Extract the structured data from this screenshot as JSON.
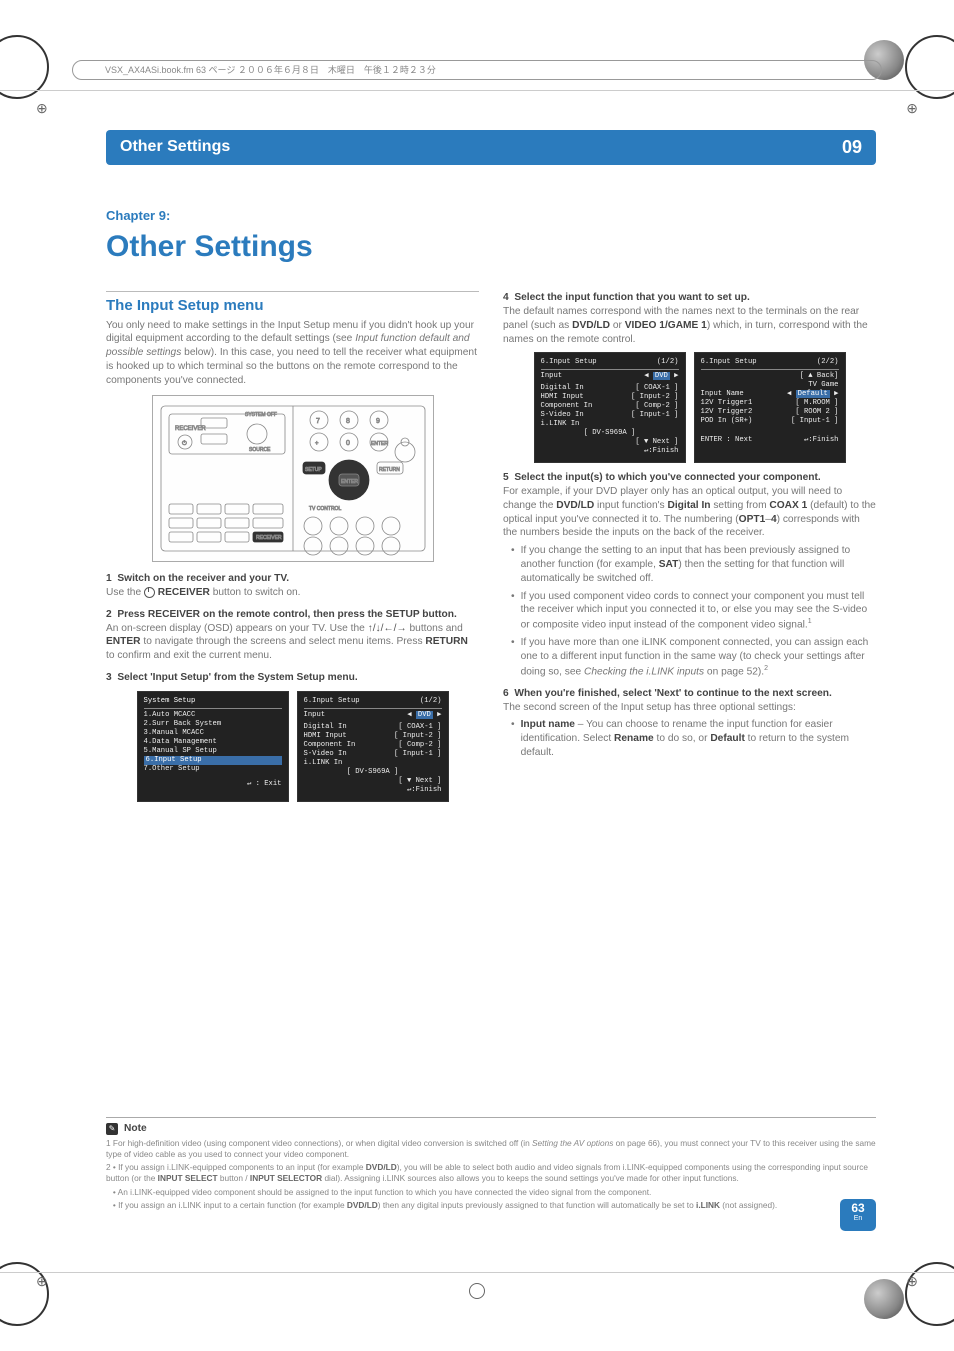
{
  "bookline": "VSX_AX4ASi.book.fm  63 ページ  ２００６年６月８日　木曜日　午後１２時２３分",
  "section_bar": {
    "title": "Other Settings",
    "num": "09"
  },
  "chapter": {
    "label": "Chapter 9:",
    "title": "Other Settings"
  },
  "h2": "The Input Setup menu",
  "intro": "You only need to make settings in the Input Setup menu if you didn't hook up your digital equipment according to the default settings (see ",
  "intro_em": "Input function default and possible settings",
  "intro2": " below). In this case, you need to tell the receiver what equipment is hooked up to which terminal so the buttons on the remote correspond to the components you've connected.",
  "step1_num": "1",
  "step1": "Switch on the receiver and your TV.",
  "step1_body_a": "Use the ",
  "step1_body_b": " RECEIVER",
  "step1_body_c": " button to switch on.",
  "step2_num": "2",
  "step2": "Press RECEIVER on the remote control, then press the SETUP button.",
  "step2_body_a": "An on-screen display (OSD) appears on your TV. Use the ",
  "step2_body_b": " buttons and ",
  "step2_body_c": "ENTER",
  "step2_body_d": " to navigate through the screens and select menu items. Press ",
  "step2_body_e": "RETURN",
  "step2_body_f": " to confirm and exit the current menu.",
  "step3_num": "3",
  "step3": "Select 'Input Setup' from the System Setup menu.",
  "osd_sys": {
    "title": "System  Setup",
    "items": [
      "1.Auto  MCACC",
      "2.Surr  Back  System",
      "3.Manual  MCACC",
      "4.Data  Management",
      "5.Manual  SP  Setup",
      "6.Input  Setup",
      "7.Other  Setup"
    ],
    "exit": ": Exit"
  },
  "osd_in1": {
    "title": "6.Input  Setup",
    "page": "(1/2)",
    "inputlbl": "Input",
    "inputval": "DVD",
    "rows": [
      [
        "Digital  In",
        "COAX-1"
      ],
      [
        "HDMI  Input",
        "Input-2"
      ],
      [
        "Component  In",
        "Comp-2"
      ],
      [
        "S-Video  In",
        "Input-1"
      ],
      [
        "i.LINK  In",
        ""
      ],
      [
        "",
        "DV-S969A"
      ]
    ],
    "next": "[ ▼ Next ]",
    "finish": ":Finish"
  },
  "step4_num": "4",
  "step4": "Select the input function that you want to set up.",
  "step4_body_a": "The default names correspond with the names next to the terminals on the rear panel (such as ",
  "step4_body_b": "DVD/LD",
  "step4_body_c": " or ",
  "step4_body_d": "VIDEO 1/GAME 1",
  "step4_body_e": ") which, in turn, correspond with the names on the remote control.",
  "osd_in1b_title": "6.Input  Setup",
  "osd_in2": {
    "title": "6.Input  Setup",
    "page": "(2/2)",
    "back": "[ ▲ Back]",
    "tvgame": "TV Game",
    "rows": [
      [
        "Input  Name",
        "Default"
      ],
      [
        "12V  Trigger1",
        "M.ROOM"
      ],
      [
        "12V  Trigger2",
        "ROOM 2"
      ],
      [
        "POD  In  (SR+)",
        "Input-1"
      ]
    ],
    "enter": "ENTER : Next",
    "finish": ":Finish"
  },
  "step5_num": "5",
  "step5": "Select the input(s) to which you've connected your component.",
  "step5_body_a": "For example, if your DVD player only has an optical output, you will need to change the ",
  "step5_body_b": "DVD/LD",
  "step5_body_c": " input function's ",
  "step5_body_d": "Digital In",
  "step5_body_e": " setting from ",
  "step5_body_f": "COAX 1",
  "step5_body_g": " (default) to the optical input you've connected it to. The numbering (",
  "step5_body_h": "OPT1",
  "step5_body_i": "–",
  "step5_body_j": "4",
  "step5_body_k": ") corresponds with the numbers beside the inputs on the back of the receiver.",
  "b1_a": "If you change the setting to an input that has been previously assigned to another function (for example, ",
  "b1_b": "SAT",
  "b1_c": ") then the setting for that function will automatically be switched off.",
  "b2": "If you used component video cords to connect your component you must tell the receiver which input you connected it to, or else you may see the S-video or composite video input instead of the component video signal.",
  "b2_sup": "1",
  "b3_a": "If you have more than one iLINK component connected, you can assign each one to a different input function in the same way (to check your settings after doing so, see ",
  "b3_em": "Checking the i.LINK inputs",
  "b3_b": " on page 52).",
  "b3_sup": "2",
  "step6_num": "6",
  "step6": "When you're finished, select 'Next' to continue to the next screen.",
  "step6_body": "The second screen of the Input setup has three optional settings:",
  "b4_a": "Input name",
  "b4_b": " – You can choose to rename the input function for easier identification. Select ",
  "b4_c": "Rename",
  "b4_d": " to do so, or ",
  "b4_e": "Default",
  "b4_f": " to return to the system default.",
  "note_label": "Note",
  "note1_a": "1 For high-definition video (using component video connections), or when digital video conversion is switched off (in ",
  "note1_em": "Setting the AV options",
  "note1_b": " on page 66), you must connect your TV to this receiver using the same type of video cable as you used to connect your video component.",
  "note2_a": "2 • If you assign i.LINK-equipped components to an input (for example ",
  "note2_b": "DVD/LD",
  "note2_c": "), you will be able to select both audio and video signals from i.LINK-equipped components using the corresponding input source button (or the ",
  "note2_d": "INPUT SELECT",
  "note2_e": " button / ",
  "note2_f": "INPUT SELECTOR",
  "note2_g": " dial). Assigning i.LINK sources also allows you to keeps the sound settings you've made for other input functions.",
  "note3": "• An i.LINK-equipped video component should be assigned to the input function to which you have connected the video signal from the component.",
  "note4_a": "• If you assign an i.LINK input to a certain function (for example ",
  "note4_b": "DVD/LD",
  "note4_c": ") then any digital inputs previously assigned to that function will automatically be set to ",
  "note4_d": "i.LINK",
  "note4_e": " (not assigned).",
  "page_number": "63",
  "page_lang": "En",
  "arrows": "↑/↓/←/→"
}
